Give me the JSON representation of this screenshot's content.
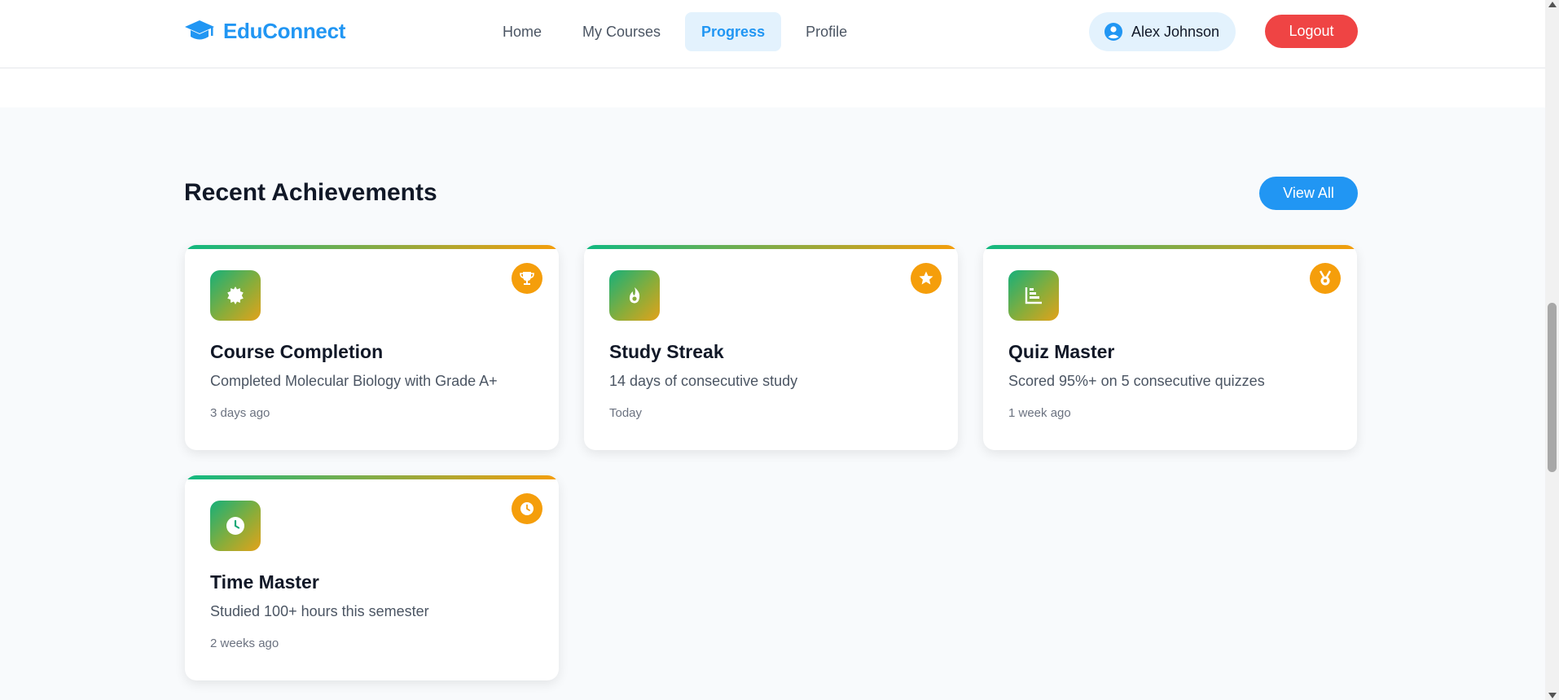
{
  "app": {
    "name": "EduConnect",
    "logo_icon": "graduation-cap-icon",
    "accent_color": "#2196f3"
  },
  "nav": {
    "items": [
      {
        "label": "Home",
        "active": false
      },
      {
        "label": "My Courses",
        "active": false
      },
      {
        "label": "Progress",
        "active": true
      },
      {
        "label": "Profile",
        "active": false
      }
    ]
  },
  "user": {
    "name": "Alex Johnson",
    "icon": "user-circle-icon",
    "logout_label": "Logout",
    "logout_color": "#ef4444"
  },
  "section": {
    "title": "Recent Achievements",
    "view_all_label": "View All"
  },
  "achievements": [
    {
      "title": "Course Completion",
      "description": "Completed Molecular Biology with Grade A+",
      "time": "3 days ago",
      "icon": "certificate-icon",
      "badge_icon": "trophy-icon"
    },
    {
      "title": "Study Streak",
      "description": "14 days of consecutive study",
      "time": "Today",
      "icon": "fire-icon",
      "badge_icon": "star-icon"
    },
    {
      "title": "Quiz Master",
      "description": "Scored 95%+ on 5 consecutive quizzes",
      "time": "1 week ago",
      "icon": "bar-chart-icon",
      "badge_icon": "medal-icon"
    },
    {
      "title": "Time Master",
      "description": "Studied 100+ hours this semester",
      "time": "2 weeks ago",
      "icon": "clock-icon",
      "badge_icon": "clock-icon"
    }
  ],
  "colors": {
    "badge": "#f59e0b",
    "card_gradient_start": "#10b981",
    "card_gradient_end": "#f59e0b"
  }
}
